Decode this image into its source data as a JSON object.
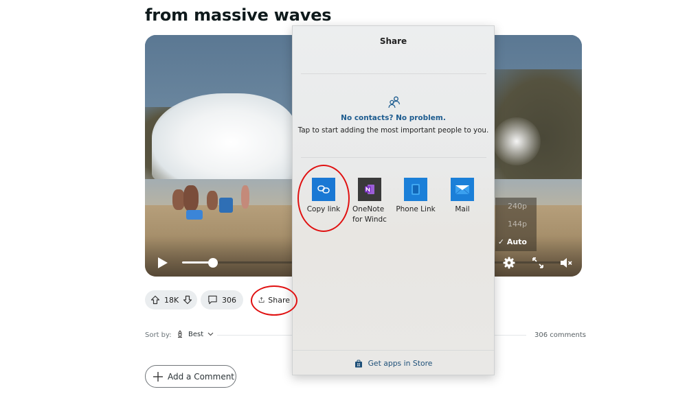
{
  "post": {
    "title": "from massive waves"
  },
  "video": {
    "progress_fraction": 0.08,
    "quality_menu": {
      "options": [
        "240p",
        "144p",
        "Auto"
      ],
      "selected": "Auto",
      "check_mark": "✓"
    },
    "controls": [
      "play-icon",
      "settings-gear-icon",
      "fullscreen-icon",
      "mute-icon"
    ]
  },
  "actions": {
    "votes": "18K",
    "comments": "306",
    "share_label": "Share"
  },
  "sort": {
    "label": "Sort by:",
    "selected": "Best",
    "comment_count": "306 comments"
  },
  "add_comment": {
    "label": "Add a Comment"
  },
  "share_dialog": {
    "title": "Share",
    "no_contacts_heading": "No contacts? No problem.",
    "no_contacts_hint": "Tap to start adding the most important people to you.",
    "apps": [
      {
        "label": "Copy link",
        "icon": "link-icon",
        "color": "#1a78d4"
      },
      {
        "label": "OneNote for Windows",
        "label_visible": "OneNote for Windc",
        "icon": "onenote-icon",
        "color": "#3a3a3a",
        "accent": "#7b3fc4"
      },
      {
        "label": "Phone Link",
        "icon": "phone-link-icon",
        "color": "#1b7fd8"
      },
      {
        "label": "Mail",
        "icon": "mail-icon",
        "color": "#1b7fd8"
      }
    ],
    "store_link": "Get apps in Store"
  },
  "annotations": {
    "color": "#e01010",
    "circled": [
      "Copy link",
      "Share"
    ]
  }
}
